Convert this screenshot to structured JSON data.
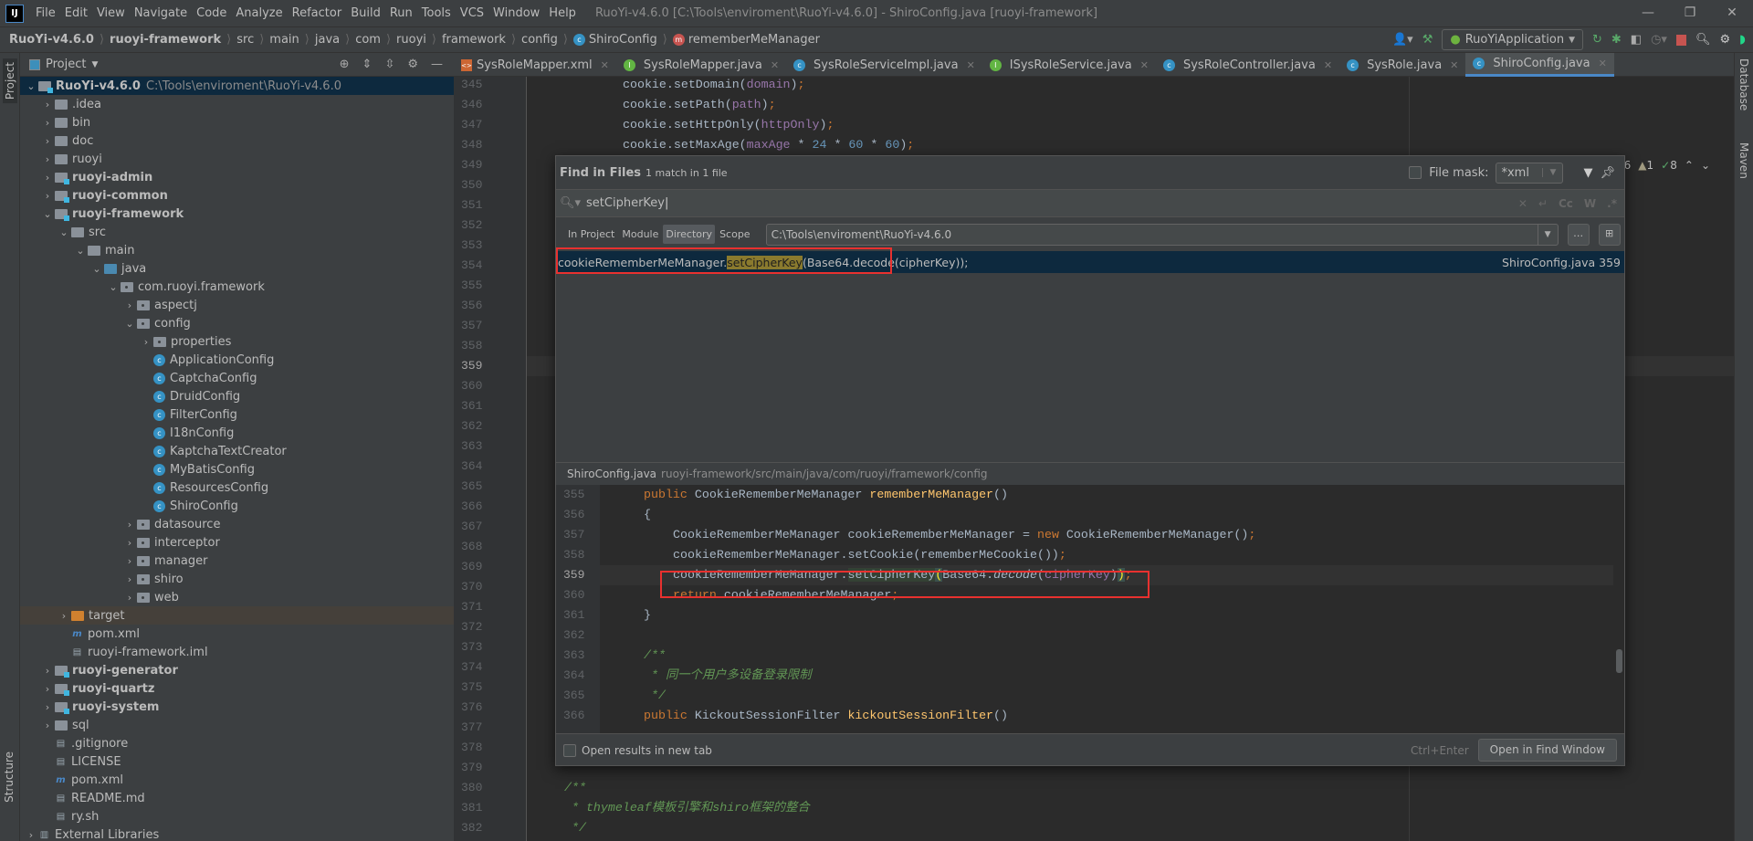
{
  "menubar": {
    "items": [
      "File",
      "Edit",
      "View",
      "Navigate",
      "Code",
      "Analyze",
      "Refactor",
      "Build",
      "Run",
      "Tools",
      "VCS",
      "Window",
      "Help"
    ],
    "title": "RuoYi-v4.6.0 [C:\\Tools\\enviroment\\RuoYi-v4.6.0] - ShiroConfig.java [ruoyi-framework]"
  },
  "breadcrumb": [
    "RuoYi-v4.6.0",
    "ruoyi-framework",
    "src",
    "main",
    "java",
    "com",
    "ruoyi",
    "framework",
    "config",
    "ShiroConfig",
    "rememberMeManager"
  ],
  "toolbar": {
    "run_config": "RuoYiApplication"
  },
  "stripes": {
    "left_top": "Project",
    "left_bottom": "Structure",
    "right_1": "Database",
    "right_2": "Maven"
  },
  "project": {
    "header": "Project",
    "tree": [
      {
        "label": "RuoYi-v4.6.0",
        "depth": 0,
        "kind": "mod",
        "bold": true,
        "open": true,
        "sel": true,
        "path": "C:\\Tools\\enviroment\\RuoYi-v4.6.0"
      },
      {
        "label": ".idea",
        "depth": 1,
        "kind": "folder"
      },
      {
        "label": "bin",
        "depth": 1,
        "kind": "folder"
      },
      {
        "label": "doc",
        "depth": 1,
        "kind": "folder"
      },
      {
        "label": "ruoyi",
        "depth": 1,
        "kind": "folder"
      },
      {
        "label": "ruoyi-admin",
        "depth": 1,
        "kind": "mod",
        "bold": true
      },
      {
        "label": "ruoyi-common",
        "depth": 1,
        "kind": "mod",
        "bold": true
      },
      {
        "label": "ruoyi-framework",
        "depth": 1,
        "kind": "mod",
        "bold": true,
        "open": true
      },
      {
        "label": "src",
        "depth": 2,
        "kind": "folder",
        "open": true
      },
      {
        "label": "main",
        "depth": 3,
        "kind": "folder",
        "open": true
      },
      {
        "label": "java",
        "depth": 4,
        "kind": "src",
        "open": true
      },
      {
        "label": "com.ruoyi.framework",
        "depth": 5,
        "kind": "pkg",
        "open": true
      },
      {
        "label": "aspectj",
        "depth": 6,
        "kind": "pkg"
      },
      {
        "label": "config",
        "depth": 6,
        "kind": "pkg",
        "open": true
      },
      {
        "label": "properties",
        "depth": 7,
        "kind": "pkg"
      },
      {
        "label": "ApplicationConfig",
        "depth": 7,
        "kind": "class"
      },
      {
        "label": "CaptchaConfig",
        "depth": 7,
        "kind": "class"
      },
      {
        "label": "DruidConfig",
        "depth": 7,
        "kind": "class"
      },
      {
        "label": "FilterConfig",
        "depth": 7,
        "kind": "class"
      },
      {
        "label": "I18nConfig",
        "depth": 7,
        "kind": "class"
      },
      {
        "label": "KaptchaTextCreator",
        "depth": 7,
        "kind": "class"
      },
      {
        "label": "MyBatisConfig",
        "depth": 7,
        "kind": "class"
      },
      {
        "label": "ResourcesConfig",
        "depth": 7,
        "kind": "class"
      },
      {
        "label": "ShiroConfig",
        "depth": 7,
        "kind": "class"
      },
      {
        "label": "datasource",
        "depth": 6,
        "kind": "pkg"
      },
      {
        "label": "interceptor",
        "depth": 6,
        "kind": "pkg"
      },
      {
        "label": "manager",
        "depth": 6,
        "kind": "pkg"
      },
      {
        "label": "shiro",
        "depth": 6,
        "kind": "pkg"
      },
      {
        "label": "web",
        "depth": 6,
        "kind": "pkg"
      },
      {
        "label": "target",
        "depth": 2,
        "kind": "orange",
        "hl": true
      },
      {
        "label": "pom.xml",
        "depth": 2,
        "kind": "pom"
      },
      {
        "label": "ruoyi-framework.iml",
        "depth": 2,
        "kind": "iml"
      },
      {
        "label": "ruoyi-generator",
        "depth": 1,
        "kind": "mod",
        "bold": true
      },
      {
        "label": "ruoyi-quartz",
        "depth": 1,
        "kind": "mod",
        "bold": true
      },
      {
        "label": "ruoyi-system",
        "depth": 1,
        "kind": "mod",
        "bold": true
      },
      {
        "label": "sql",
        "depth": 1,
        "kind": "folder"
      },
      {
        "label": ".gitignore",
        "depth": 1,
        "kind": "file"
      },
      {
        "label": "LICENSE",
        "depth": 1,
        "kind": "file"
      },
      {
        "label": "pom.xml",
        "depth": 1,
        "kind": "pom"
      },
      {
        "label": "README.md",
        "depth": 1,
        "kind": "file"
      },
      {
        "label": "ry.sh",
        "depth": 1,
        "kind": "file"
      },
      {
        "label": "External Libraries",
        "depth": 0,
        "kind": "lib"
      }
    ]
  },
  "tabs": [
    {
      "label": "SysRoleMapper.xml",
      "icon": "xml"
    },
    {
      "label": "SysRoleMapper.java",
      "icon": "interface"
    },
    {
      "label": "SysRoleServiceImpl.java",
      "icon": "class"
    },
    {
      "label": "ISysRoleService.java",
      "icon": "interface"
    },
    {
      "label": "SysRoleController.java",
      "icon": "class"
    },
    {
      "label": "SysRole.java",
      "icon": "class"
    },
    {
      "label": "ShiroConfig.java",
      "icon": "class",
      "active": true
    }
  ],
  "inspections": {
    "warnings": "6",
    "weak_warnings": "1",
    "typos": "8"
  },
  "editor": {
    "first_line": 345,
    "last_line": 382,
    "current_line": 359,
    "lines": [
      {
        "n": 345,
        "indent": 2,
        "tokens": [
          [
            "cookie.setDomain(",
            ""
          ],
          [
            "domain",
            "f"
          ],
          [
            ")",
            ""
          ],
          [
            ";",
            "k"
          ]
        ]
      },
      {
        "n": 346,
        "indent": 2,
        "tokens": [
          [
            "cookie.setPath(",
            ""
          ],
          [
            "path",
            "f"
          ],
          [
            ")",
            ""
          ],
          [
            ";",
            "k"
          ]
        ]
      },
      {
        "n": 347,
        "indent": 2,
        "tokens": [
          [
            "cookie.setHttpOnly(",
            ""
          ],
          [
            "httpOnly",
            "f"
          ],
          [
            ")",
            ""
          ],
          [
            ";",
            "k"
          ]
        ]
      },
      {
        "n": 348,
        "indent": 2,
        "tokens": [
          [
            "cookie.setMaxAge(",
            ""
          ],
          [
            "maxAge",
            "f"
          ],
          [
            " * ",
            ""
          ],
          [
            "24",
            "n"
          ],
          [
            " * ",
            ""
          ],
          [
            "60",
            "n"
          ],
          [
            " * ",
            ""
          ],
          [
            "60",
            "n"
          ],
          [
            ")",
            ""
          ],
          [
            ";",
            "k"
          ]
        ]
      },
      {
        "n": 380,
        "indent": 0,
        "tokens": [
          [
            "/**",
            "c"
          ]
        ]
      },
      {
        "n": 381,
        "indent": 0,
        "tokens": [
          [
            " * thymeleaf模板引擎和shiro框架的整合",
            "c"
          ]
        ]
      },
      {
        "n": 382,
        "indent": 0,
        "tokens": [
          [
            " */",
            "c"
          ]
        ]
      }
    ]
  },
  "find": {
    "title": "Find in Files",
    "summary": "1 match in 1 file",
    "file_mask_label": "File mask:",
    "file_mask_value": "*xml",
    "query": "setCipherKey",
    "options": [
      "Cc",
      "W",
      ".*"
    ],
    "scopes": [
      {
        "label": "In Project"
      },
      {
        "label": "Module"
      },
      {
        "label": "Directory",
        "active": true
      },
      {
        "label": "Scope"
      }
    ],
    "directory": "C:\\Tools\\enviroment\\RuoYi-v4.6.0",
    "result": {
      "before": "cookieRememberMeManager.",
      "match": "setCipherKey",
      "after": "(Base64.decode(cipherKey));",
      "file": "ShiroConfig.java 359"
    },
    "preview_file": "ShiroConfig.java",
    "preview_path": "ruoyi-framework/src/main/java/com/ruoyi/framework/config",
    "preview_current": 359,
    "preview": [
      {
        "n": 355,
        "indent": 1,
        "tokens": [
          [
            "public ",
            "k"
          ],
          [
            "CookieRememberMeManager ",
            ""
          ],
          [
            "rememberMeManager",
            "md"
          ],
          [
            "()",
            ""
          ]
        ]
      },
      {
        "n": 356,
        "indent": 1,
        "tokens": [
          [
            "{",
            ""
          ]
        ]
      },
      {
        "n": 357,
        "indent": 2,
        "tokens": [
          [
            "CookieRememberMeManager cookieRememberMeManager = ",
            ""
          ],
          [
            "new ",
            "k"
          ],
          [
            "CookieRememberMeManager()",
            ""
          ],
          [
            ";",
            "k"
          ]
        ]
      },
      {
        "n": 358,
        "indent": 2,
        "tokens": [
          [
            "cookieRememberMeManager.setCookie(rememberMeCookie())",
            ""
          ],
          [
            ";",
            "k"
          ]
        ]
      },
      {
        "n": 359,
        "indent": 2,
        "tokens": [
          [
            "cookieRememberMeManager.",
            ""
          ],
          [
            "setCipherKey",
            "hk"
          ],
          [
            "(",
            "br"
          ],
          [
            "Base64.",
            ""
          ],
          [
            "decode",
            "it"
          ],
          [
            "(",
            ""
          ],
          [
            "cipherKey",
            "f"
          ],
          [
            ")",
            ""
          ],
          [
            ")",
            "br"
          ],
          [
            ";",
            "k"
          ]
        ]
      },
      {
        "n": 360,
        "indent": 2,
        "tokens": [
          [
            "return ",
            "k"
          ],
          [
            "cookieRememberMeManager",
            ""
          ],
          [
            ";",
            "k"
          ]
        ]
      },
      {
        "n": 361,
        "indent": 1,
        "tokens": [
          [
            "}",
            ""
          ]
        ]
      },
      {
        "n": 362,
        "indent": 0,
        "tokens": []
      },
      {
        "n": 363,
        "indent": 1,
        "tokens": [
          [
            "/**",
            "c"
          ]
        ]
      },
      {
        "n": 364,
        "indent": 1,
        "tokens": [
          [
            " * 同一个用户多设备登录限制",
            "c"
          ]
        ]
      },
      {
        "n": 365,
        "indent": 1,
        "tokens": [
          [
            " */",
            "c"
          ]
        ]
      },
      {
        "n": 366,
        "indent": 1,
        "tokens": [
          [
            "public ",
            "k"
          ],
          [
            "KickoutSessionFilter ",
            ""
          ],
          [
            "kickoutSessionFilter",
            "md"
          ],
          [
            "()",
            ""
          ]
        ]
      }
    ],
    "open_new_tab_label": "Open results in new tab",
    "shortcut": "Ctrl+Enter",
    "open_button": "Open in Find Window"
  },
  "colors": {
    "accent": "#4a88c7",
    "highlight_box": "#e8312f",
    "selection": "#0d293e"
  }
}
